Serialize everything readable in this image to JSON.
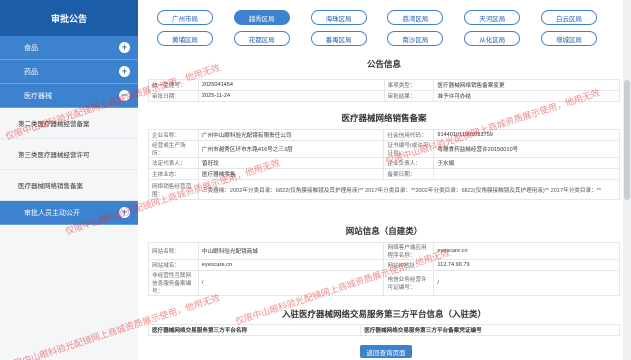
{
  "sidebar": {
    "title": "审批公告",
    "items": [
      {
        "label": "食品",
        "toggle": "+"
      },
      {
        "label": "药品",
        "toggle": "+"
      },
      {
        "label": "医疗器械",
        "toggle": "−"
      }
    ],
    "subitems": [
      "第二类医疗器械经营备案",
      "第三类医疗器械经营许可",
      "医疗器械网络销售备案"
    ],
    "last_item": {
      "label": "审批人员主动公开",
      "toggle": "+"
    }
  },
  "districts": {
    "row1": [
      "广州市局",
      "越秀区局",
      "海珠区局",
      "荔湾区局",
      "天河区局",
      "白云区局"
    ],
    "row2": [
      "黄埔区局",
      "花都区局",
      "番禺区局",
      "南沙区局",
      "从化区局",
      "增城区局"
    ],
    "active": "越秀区局"
  },
  "announcement": {
    "title": "公告信息",
    "rows": [
      {
        "k1": "统一受理号：",
        "v1": "2025041454",
        "k2": "事项类型：",
        "v2": "医疗器械网络销售备案变更"
      },
      {
        "k1": "审批日期：",
        "v1": "2025-11-24",
        "k2": "审批结果：",
        "v2": "准予许可办结"
      }
    ]
  },
  "filing": {
    "title": "医疗器械网络销售备案",
    "rows": [
      {
        "k1": "企业名称：",
        "v1": "广州中山眼科验光配镜有限责任公司",
        "k2": "社会信用代码：",
        "v2": "91440101190505375​9"
      },
      {
        "k1": "经营或生产场所：",
        "v1": "广州市越秀区环市东路416号之三3层",
        "k2": "证书编号(或许可证号)：",
        "v2": "粤穗食药监械经营许20150010号"
      },
      {
        "k1": "法定代表人：",
        "v1": "曾旺玟",
        "k2": "企业负责人：",
        "v2": "于水娟"
      },
      {
        "k1": "主体业态：",
        "v1": "医疗器械零售",
        "k2": "备案日期：",
        "v2": ""
      }
    ],
    "scope_label": "网络销售经营范围：",
    "scope_value": "三类器械：2002年分类目录：6822(仅角膜接触镜及其护理用液)** 2017年分类目录：**2002年分类目录：6822(仅角膜接触镜及其护理用液)** 2017年分类目录：**"
  },
  "website": {
    "title": "网站信息（自建类）",
    "rows": [
      {
        "k1": "网站名称：",
        "v1": "中山眼科验光配镜商城",
        "k2": "网络客户端应用程序名称：",
        "v2": "eyescare.cn"
      },
      {
        "k1": "网站域名：",
        "v1": "eyescare.cn",
        "k2": "网站IP地址：",
        "v2": "112.74.90.79"
      },
      {
        "k1": "非经营性互联网信息服务备案编号：",
        "v1": "/",
        "k2": "电信业务经营许可证编号：",
        "v2": "/"
      }
    ]
  },
  "platform": {
    "title": "入驻医疗器械网络交易服务第三方平台信息（入驻类）",
    "col1": "医疗器械网络交易服务第三方平台名称",
    "col2": "医疗器械网络交易服务第三方平台备案凭证编号"
  },
  "search_button": "返回查询页面",
  "watermark": "仅限中山眼科验光配镜网上商城资质展示使用，他用无效"
}
